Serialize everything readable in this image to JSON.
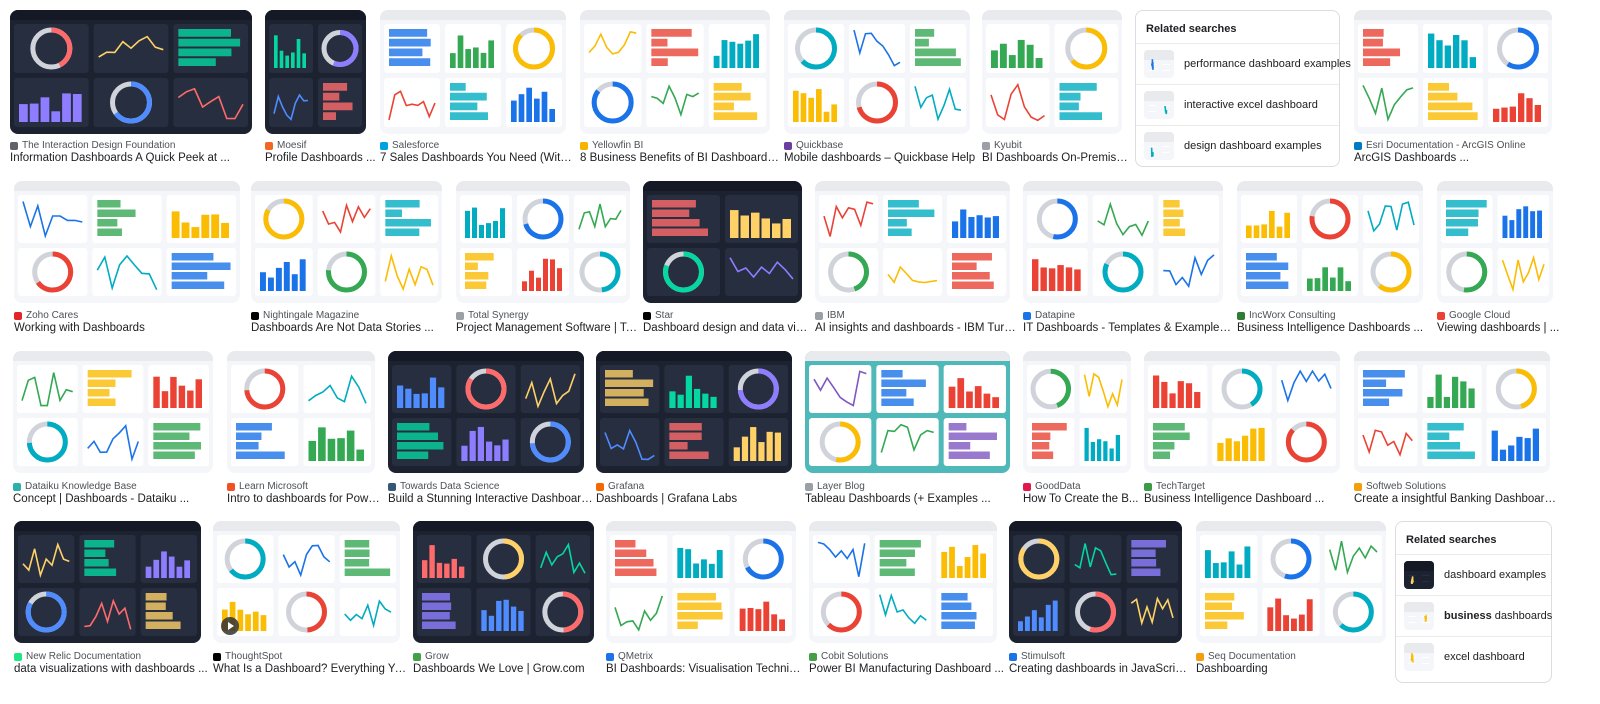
{
  "results": [
    {
      "source": "The Interaction Design Foundation",
      "title": "Information Dashboards A Quick Peek at ...",
      "theme": "dark",
      "favicon_color": "#5f6368"
    },
    {
      "source": "Moesif",
      "title": "Profile Dashboards ...",
      "theme": "dark",
      "favicon_color": "#f26522"
    },
    {
      "source": "Salesforce",
      "title": "7 Sales Dashboards You Need (With ...",
      "theme": "light",
      "favicon_color": "#00a1e0"
    },
    {
      "source": "Yellowfin BI",
      "title": "8 Business Benefits of BI Dashboards ...",
      "theme": "light",
      "favicon_color": "#f5b400"
    },
    {
      "source": "Quickbase",
      "title": "Mobile dashboards – Quickbase Help",
      "theme": "light",
      "favicon_color": "#6b3fa0"
    },
    {
      "source": "Kyubit",
      "title": "BI Dashboards On-Premise...",
      "theme": "light",
      "favicon_color": "#9aa0a6"
    },
    {
      "source": "Esri Documentation - ArcGIS Online",
      "title": "ArcGIS Dashboards ...",
      "theme": "light",
      "favicon_color": "#007ac2"
    },
    {
      "source": "Zoho Cares",
      "title": "Working with Dashboards",
      "theme": "light",
      "favicon_color": "#e42527"
    },
    {
      "source": "Nightingale Magazine",
      "title": "Dashboards Are Not Data Stories ...",
      "theme": "light",
      "favicon_color": "#000000"
    },
    {
      "source": "Total Synergy",
      "title": "Project Management Software | Tot...",
      "theme": "light",
      "favicon_color": "#9aa0a6"
    },
    {
      "source": "Star",
      "title": "Dashboard design and data visu...",
      "theme": "dark",
      "favicon_color": "#000000"
    },
    {
      "source": "IBM",
      "title": "AI insights and dashboards - IBM Turbo...",
      "theme": "light",
      "favicon_color": "#9aa0a6"
    },
    {
      "source": "Datapine",
      "title": "IT Dashboards - Templates & Examples ...",
      "theme": "light",
      "favicon_color": "#1a73e8"
    },
    {
      "source": "IncWorx Consulting",
      "title": "Business Intelligence Dashboards ...",
      "theme": "light",
      "favicon_color": "#2e7d32"
    },
    {
      "source": "Google Cloud",
      "title": "Viewing dashboards | ...",
      "theme": "light",
      "favicon_color": "#ea4335"
    },
    {
      "source": "Dataiku Knowledge Base",
      "title": "Concept | Dashboards - Dataiku ...",
      "theme": "light",
      "favicon_color": "#2ab1ac"
    },
    {
      "source": "Learn Microsoft",
      "title": "Intro to dashboards for Power ...",
      "theme": "light",
      "favicon_color": "#f25022"
    },
    {
      "source": "Towards Data Science",
      "title": "Build a Stunning Interactive Dashboard ...",
      "theme": "dark",
      "favicon_color": "#355876"
    },
    {
      "source": "Grafana",
      "title": "Dashboards | Grafana Labs",
      "theme": "dark",
      "favicon_color": "#f46800"
    },
    {
      "source": "Layer Blog",
      "title": "Tableau Dashboards (+ Examples ...",
      "theme": "teal",
      "favicon_color": "#9aa0a6"
    },
    {
      "source": "GoodData",
      "title": "How To Create the B...",
      "theme": "light",
      "favicon_color": "#e4174d"
    },
    {
      "source": "TechTarget",
      "title": "Business Intelligence Dashboard ...",
      "theme": "light",
      "favicon_color": "#3b9c45"
    },
    {
      "source": "Softweb Solutions",
      "title": "Create a insightful Banking Dashboards ...",
      "theme": "light",
      "favicon_color": "#f59e0b"
    },
    {
      "source": "New Relic Documentation",
      "title": "data visualizations with dashboards ...",
      "theme": "dark",
      "favicon_color": "#1ce783"
    },
    {
      "source": "ThoughtSpot",
      "title": "What Is a Dashboard? Everything You ...",
      "theme": "light",
      "favicon_color": "#000000"
    },
    {
      "source": "Grow",
      "title": "Dashboards We Love | Grow.com",
      "theme": "dark",
      "favicon_color": "#43a047"
    },
    {
      "source": "QMetrix",
      "title": "BI Dashboards: Visualisation Technique...",
      "theme": "light",
      "favicon_color": "#1a73e8"
    },
    {
      "source": "Cobit Solutions",
      "title": "Power BI Manufacturing Dashboard ...",
      "theme": "light",
      "favicon_color": "#43a047"
    },
    {
      "source": "Stimulsoft",
      "title": "Creating dashboards in JavaScript ...",
      "theme": "dark",
      "favicon_color": "#1a73e8"
    },
    {
      "source": "Seq Documentation",
      "title": "Dashboarding",
      "theme": "light",
      "favicon_color": "#f59e0b"
    }
  ],
  "related_1": {
    "heading": "Related searches",
    "items": [
      {
        "text": "performance dashboard examples"
      },
      {
        "text": "interactive excel dashboard"
      },
      {
        "text": "design dashboard examples"
      }
    ]
  },
  "related_2": {
    "heading": "Related searches",
    "items": [
      {
        "text": "dashboard examples",
        "bold": ""
      },
      {
        "text": " dashboards",
        "bold": "business"
      },
      {
        "text": "excel dashboard",
        "bold": ""
      }
    ]
  },
  "colors": {
    "accent": "#1a73e8",
    "text": "#202124",
    "muted": "#4d5156",
    "border": "#dadce0"
  }
}
